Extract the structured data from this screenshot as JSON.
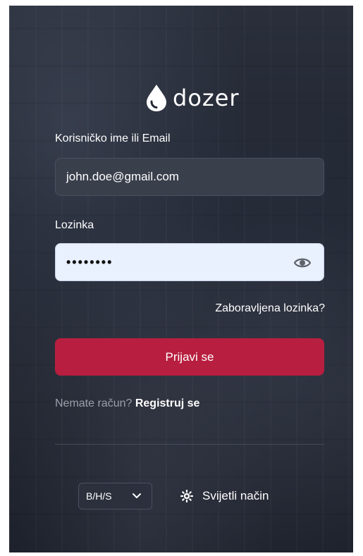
{
  "brand": {
    "name": "dozer",
    "icon": "water-drop-icon"
  },
  "form": {
    "username_label": "Korisničko ime ili Email",
    "username_value": "john.doe@gmail.com",
    "password_label": "Lozinka",
    "password_value": "••••••••",
    "show_password_icon": "eye-icon",
    "forgot_password": "Zaboravljena lozinka?",
    "login_button": "Prijavi se",
    "no_account_text": "Nemate račun?",
    "register_link": "Registruj se"
  },
  "footer": {
    "language_value": "B/H/S",
    "language_icon": "chevron-down-icon",
    "theme_label": "Svijetli način",
    "theme_icon": "sun-icon"
  },
  "colors": {
    "primary": "#b81e3f",
    "input_dark": "#3a3f4c",
    "input_light": "#e9f0fe",
    "background": "#232733"
  }
}
